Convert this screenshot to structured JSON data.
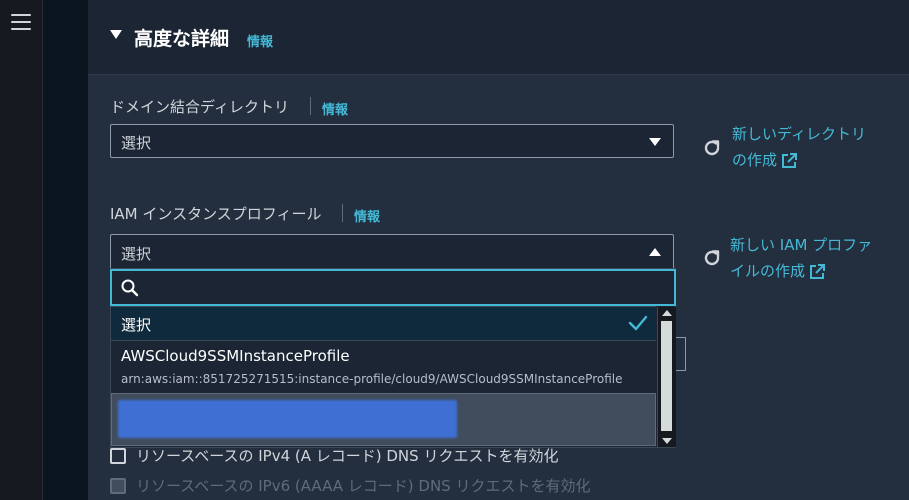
{
  "section": {
    "title": "高度な詳細",
    "info": "情報"
  },
  "domain_join": {
    "label": "ドメイン結合ディレクトリ",
    "info": "情報",
    "select_value": "選択",
    "create_link_line1": "新しいディレクトリ",
    "create_link_line2": "の作成"
  },
  "iam_profile": {
    "label": "IAM インスタンスプロフィール",
    "info": "情報",
    "select_value": "選択",
    "create_link_line1": "新しい IAM プロファ",
    "create_link_line2": "イルの作成"
  },
  "dropdown": {
    "search_placeholder": "",
    "options": [
      {
        "label": "選択",
        "selected": true
      },
      {
        "label": "AWSCloud9SSMInstanceProfile",
        "description": "arn:aws:iam::851725271515:instance-profile/cloud9/AWSCloud9SSMInstanceProfile"
      }
    ]
  },
  "checkboxes": {
    "ipv4": "リソースベースの IPv4 (A レコード) DNS リクエストを有効化",
    "ipv6": "リソースベースの IPv6 (AAAA レコード) DNS リクエストを有効化"
  },
  "colors": {
    "accent": "#44b9d6",
    "panel": "#232f3e",
    "focus": "#44b9d6"
  },
  "icons": [
    "menu-icon",
    "refresh-icon",
    "external-link-icon",
    "search-icon",
    "check-icon"
  ]
}
